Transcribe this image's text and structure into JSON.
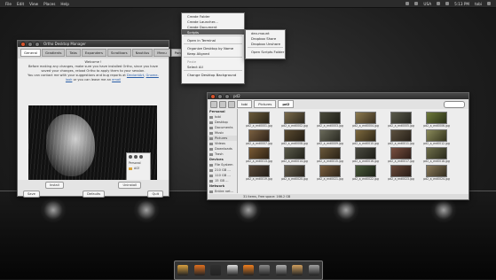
{
  "topbar": {
    "menu": [
      "File",
      "Edit",
      "View",
      "Places",
      "Help"
    ],
    "country": "USA",
    "time": "5:13 PM",
    "user": "tobi"
  },
  "ortho": {
    "title": "Ortho Desktop Manager",
    "tabs": [
      "General",
      "Gradients",
      "Tabs",
      "Expanders",
      "Scrollbars",
      "Nautilus",
      "Menu",
      "Panel",
      "Fixes"
    ],
    "welcome_title": "Welcome !",
    "welcome_text": "Before making any changes, make sure you have installed Ortho, since you have saved your changes, reload Ortho to apply them to your session.",
    "contact_text": "You can contact me with your suggestions and bug reports at",
    "link1": "DeviantArt",
    "or_text": "or",
    "link2": "Gnome-look",
    "or_leave": "or you can leave me an",
    "link3": "email",
    "mini_personal": "Personal",
    "mini_item": "ACE",
    "install": "Install",
    "uninstall": "Uninstall",
    "save": "Save",
    "defaults": "Defaults",
    "quit": "Quit"
  },
  "context_menu": {
    "items": [
      "Create Folder",
      "Create Launcher...",
      "Create Document",
      "Scripts",
      "Open in Terminal",
      "Organize Desktop by Name",
      "Keep Aligned",
      "Paste",
      "Select All",
      "Change Desktop Background"
    ],
    "submenu": [
      "dev-mount",
      "Dropbox Share",
      "Dropbox Unshare",
      "Open Scripts Folder"
    ]
  },
  "files": {
    "title": "pd2",
    "crumbs": [
      "tobi",
      "Pictures",
      "pd2"
    ],
    "personal": "Personal",
    "places": [
      "tobi",
      "Desktop",
      "Documents",
      "Music",
      "Pictures",
      "Videos",
      "Downloads",
      "Trash"
    ],
    "devices": "Devices",
    "device_items": [
      "File System",
      "210 GB ...",
      "110 GB ...",
      "15 GB ..."
    ],
    "network": "Network",
    "network_items": [
      "Entire net..."
    ],
    "thumbs": [
      {
        "name": "pd2_a_ent0001.jpg",
        "c1": "#6a5a3a",
        "c2": "#2a2418"
      },
      {
        "name": "pd2_a_ent0002.jpg",
        "c1": "#7a6a4a",
        "c2": "#2e2a1f"
      },
      {
        "name": "pd2_a_ent0003.jpg",
        "c1": "#4a4a3a",
        "c2": "#1f1f18"
      },
      {
        "name": "pd2_a_ent0004.jpg",
        "c1": "#8c7a4e",
        "c2": "#3a3020"
      },
      {
        "name": "pd2_a_ent0005.jpg",
        "c1": "#5a5a4a",
        "c2": "#262620"
      },
      {
        "name": "pd2_a_ent0006.jpg",
        "c1": "#6e7a3a",
        "c2": "#2a3018"
      },
      {
        "name": "pd2_a_ent0007.jpg",
        "c1": "#7a6040",
        "c2": "#30241a"
      },
      {
        "name": "pd2_a_ent0008.jpg",
        "c1": "#5a4a30",
        "c2": "#241e14"
      },
      {
        "name": "pd2_a_ent0009.jpg",
        "c1": "#6a6a5a",
        "c2": "#2a2a22"
      },
      {
        "name": "pd2_a_ent0010.jpg",
        "c1": "#7e6a3e",
        "c2": "#302818"
      },
      {
        "name": "pd2_a_ent0011.jpg",
        "c1": "#5e5240",
        "c2": "#262018"
      },
      {
        "name": "pd2_a_ent0012.jpg",
        "c1": "#8a8a5a",
        "c2": "#34341e"
      },
      {
        "name": "pd2_a_ent0013.jpg",
        "c1": "#7a5a34",
        "c2": "#2e2214"
      },
      {
        "name": "pd2_a_ent0014.jpg",
        "c1": "#5a5a4a",
        "c2": "#22221a"
      },
      {
        "name": "pd2_a_ent0015.jpg",
        "c1": "#6a583a",
        "c2": "#2a2216"
      },
      {
        "name": "pd2_a_ent0016.jpg",
        "c1": "#4a4a40",
        "c2": "#1e1e18"
      },
      {
        "name": "pd2_a_ent0017.jpg",
        "c1": "#7a5040",
        "c2": "#2e1e18"
      },
      {
        "name": "pd2_a_ent0018.jpg",
        "c1": "#6e6e4a",
        "c2": "#2a2a1c"
      },
      {
        "name": "pd2_a_ent0019.jpg",
        "c1": "#5a4a3a",
        "c2": "#221c16"
      },
      {
        "name": "pd2_a_ent0020.jpg",
        "c1": "#6a6250",
        "c2": "#28241c"
      },
      {
        "name": "pd2_a_ent0021.jpg",
        "c1": "#7a5e3e",
        "c2": "#2e2418"
      },
      {
        "name": "pd2_a_ent0022.jpg",
        "c1": "#4a5a3a",
        "c2": "#1c2216"
      },
      {
        "name": "pd2_a_ent0023.jpg",
        "c1": "#6a4a3a",
        "c2": "#281c16"
      },
      {
        "name": "pd2_a_ent0024.jpg",
        "c1": "#8a7a5a",
        "c2": "#342e20"
      }
    ],
    "status": "31 items, Free space: 166.2 GB"
  },
  "dock": {
    "icons": [
      {
        "name": "home-folder-icon",
        "color": "#d8a040"
      },
      {
        "name": "firefox-icon",
        "color": "#e07020"
      },
      {
        "name": "terminal-icon",
        "color": "#303030"
      },
      {
        "name": "text-editor-icon",
        "color": "#e0e0e0"
      },
      {
        "name": "vlc-icon",
        "color": "#f08020"
      },
      {
        "name": "settings-icon",
        "color": "#8a8a8a"
      },
      {
        "name": "photo-viewer-icon",
        "color": "#b0b0b0"
      },
      {
        "name": "package-manager-icon",
        "color": "#d0a060"
      },
      {
        "name": "trash-icon",
        "color": "#a0a0a0"
      }
    ]
  }
}
